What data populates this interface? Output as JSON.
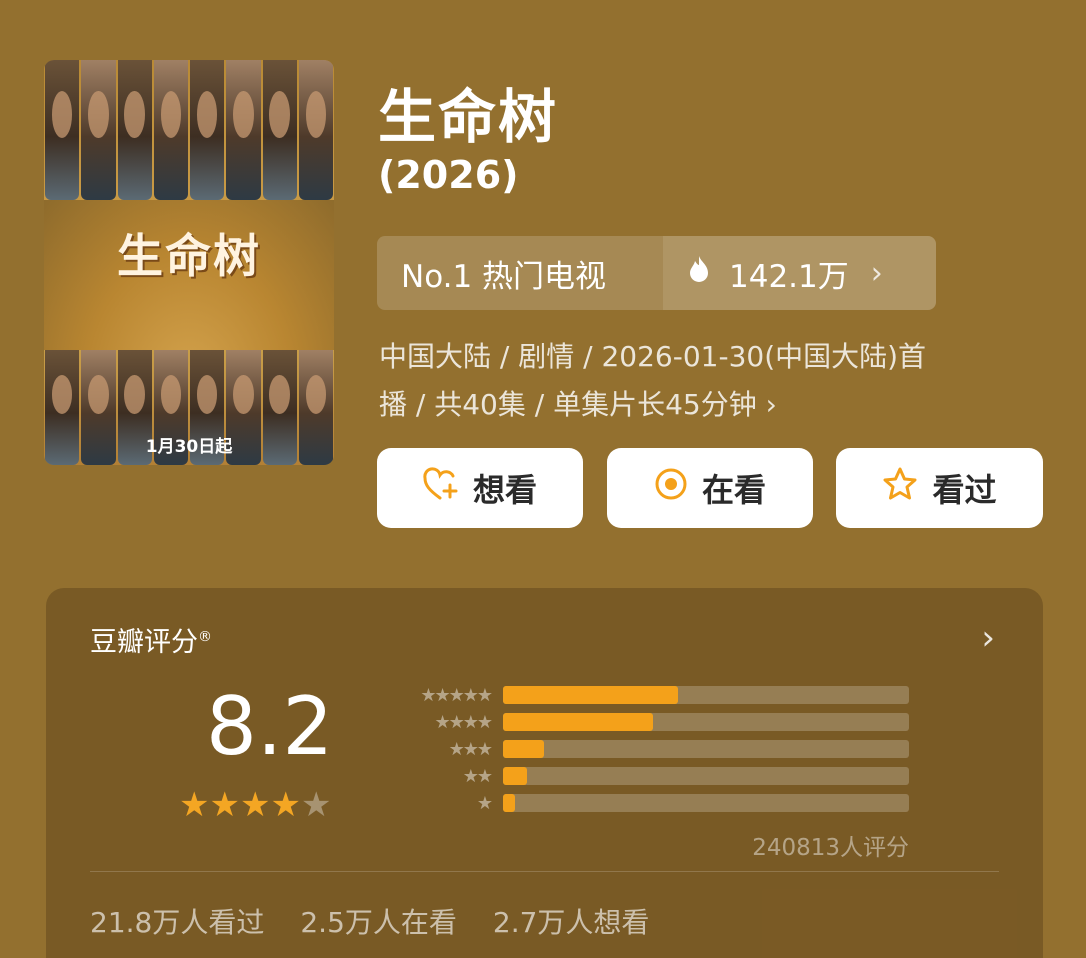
{
  "poster": {
    "title_art": "生命树",
    "date_text": "1月30日起"
  },
  "title": "生命树",
  "year": "(2026)",
  "rank": {
    "label": "No.1 热门电视",
    "heat": "142.1万"
  },
  "meta": {
    "line1": "中国大陆 / 剧情 / 2026-01-30(中国大陆)首",
    "line2": "播 / 共40集 / 单集片长45分钟 ›"
  },
  "buttons": {
    "want": "想看",
    "watching": "在看",
    "watched": "看过"
  },
  "rating": {
    "title": "豆瓣评分",
    "score": "8.2",
    "stars_filled": 4,
    "stars_total": 5,
    "distribution": [
      {
        "stars": 5,
        "fraction": 0.43
      },
      {
        "stars": 4,
        "fraction": 0.37
      },
      {
        "stars": 3,
        "fraction": 0.1
      },
      {
        "stars": 2,
        "fraction": 0.06
      },
      {
        "stars": 1,
        "fraction": 0.03
      }
    ],
    "count": "240813人评分"
  },
  "stats": {
    "watched": "21.8万人看过",
    "watching": "2.5万人在看",
    "want": "2.7万人想看"
  },
  "colors": {
    "background": "#93702f",
    "accent": "#f4a11a",
    "button_bg": "#ffffff"
  }
}
